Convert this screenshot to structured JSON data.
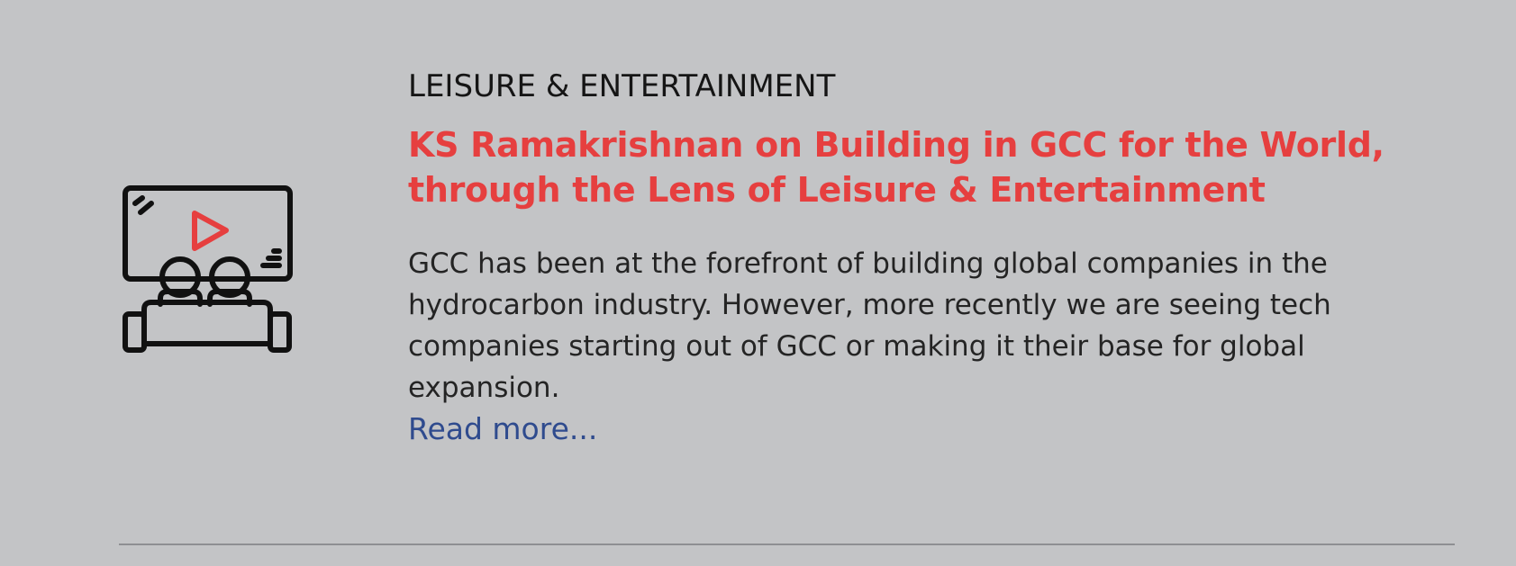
{
  "article": {
    "category": "LEISURE & ENTERTAINMENT",
    "title": "KS Ramakrishnan on Building in GCC for the World, through the Lens of Leisure & Entertainment",
    "summary": "GCC has been at the forefront of building global companies in the hydrocarbon industry. However, more recently we are seeing tech companies starting out of GCC or making it their base for global expansion.",
    "read_more_label": "Read more...",
    "icon": "cinema-couch-icon"
  },
  "colors": {
    "background": "#c3c4c6",
    "title": "#e63f3f",
    "link": "#2f4b8e",
    "text": "#242424",
    "divider": "#8e8f92"
  }
}
